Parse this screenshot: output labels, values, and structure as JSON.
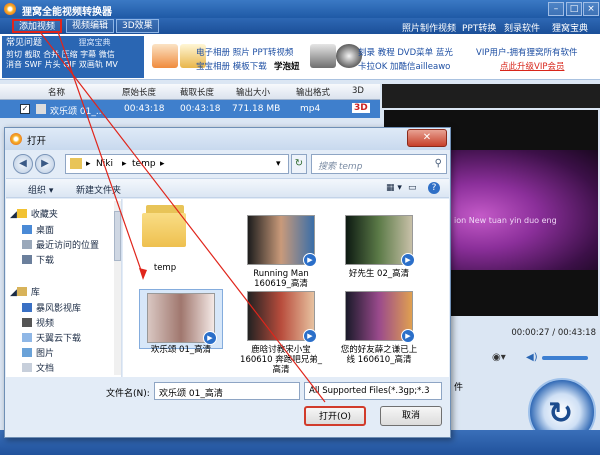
{
  "app": {
    "title": "狸窝全能视频转换器",
    "nav": {
      "add_video": "添加视频",
      "edit_video": "视频编辑",
      "effect_3d": "3D效果"
    },
    "nav_right": [
      "照片制作视频",
      "PPT转换",
      "刻录软件",
      "狸窝宝典"
    ],
    "faq": {
      "title": "常见问题",
      "brand": "狸窝宝典",
      "line1": "剪切 截取 合并 压缩 字幕 微信",
      "line2": "消音 SWF 片头 GIF 双画轨 MV"
    },
    "tools": {
      "group1_line1": "电子相册 照片 PPT转视频",
      "group1_line2": "宝宝相册 模板下载",
      "group1_bold": "学泡妞",
      "group2_line1": "刻录 教程 DVD菜单 蓝光",
      "group2_line2": "卡拉OK 加酷信ailleawo",
      "vip_line": "VIP用户-拥有狸窝所有软件",
      "vip_link": "点此升级VIP会员"
    },
    "table": {
      "headers": [
        "名称",
        "原始长度",
        "截取长度",
        "输出大小",
        "输出格式",
        "3D"
      ],
      "rows": [
        {
          "name": "欢乐颂 01_...",
          "orig": "00:43:18",
          "cut": "00:43:18",
          "size": "771.18 MB",
          "format": "mp4",
          "tag3d": "3D"
        }
      ]
    },
    "player": {
      "time": "00:00:27 / 00:43:18",
      "overlay_text": "ion  New  tuan  yin  duo  eng"
    },
    "bottom_partial": "件"
  },
  "dialog": {
    "title": "打开",
    "path": [
      "Niki",
      "temp"
    ],
    "search_placeholder": "搜索 temp",
    "organize": "组织 ▾",
    "new_folder": "新建文件夹",
    "nav_tree": {
      "favorites": "收藏夹",
      "fav_items": [
        "桌面",
        "最近访问的位置",
        "下载"
      ],
      "library": "库",
      "lib_items": [
        "暴风影视库",
        "视频",
        "天翼云下载",
        "图片",
        "文档"
      ]
    },
    "files": [
      {
        "name": "temp",
        "kind": "folder"
      },
      {
        "name": "Running Man 160619_高清",
        "kind": "video",
        "colors": [
          "#1d1d1d",
          "#c99a7a",
          "#3a6ea8"
        ]
      },
      {
        "name": "好先生 02_高清",
        "kind": "video",
        "colors": [
          "#0d1a12",
          "#5c7b48",
          "#c8c0a8"
        ]
      },
      {
        "name": "欢乐颂 01_高清",
        "kind": "video",
        "colors": [
          "#d9c7c2",
          "#a0776e",
          "#f4e9e6"
        ],
        "selected": true
      },
      {
        "name": "鹿晗讨教宋小宝 160610 奔跑吧兄弟_高清",
        "kind": "video",
        "colors": [
          "#222",
          "#b84c3c",
          "#e7c2a0"
        ]
      },
      {
        "name": "您的好友薛之谦已上线 160610_高清",
        "kind": "video",
        "colors": [
          "#1a1a2a",
          "#9a4a8c",
          "#e0a050"
        ]
      }
    ],
    "filename_label": "文件名(N):",
    "filename_value": "欢乐颂 01_高清",
    "filetype": "All Supported Files(*.3gp;*.3",
    "open_btn": "打开(O)",
    "cancel_btn": "取消"
  },
  "colors": {
    "accent": "#2a66b3",
    "annotation": "#e0251b"
  }
}
